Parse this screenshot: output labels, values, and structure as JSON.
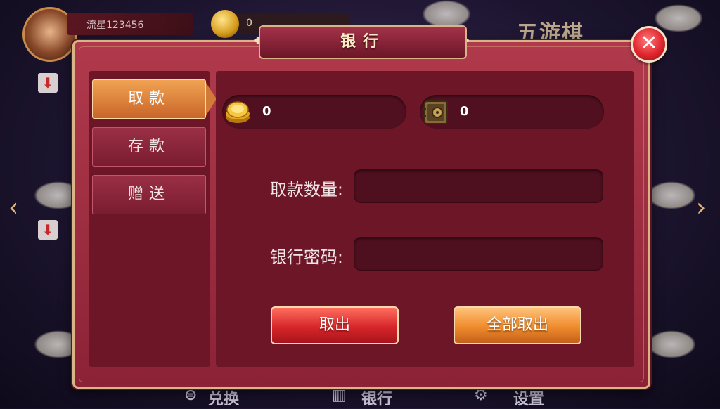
{
  "lobby": {
    "username": "流星123456",
    "coin_value": "0",
    "right_title": "五游棋",
    "bottom_nav": [
      {
        "label": "兑换",
        "icon": "exchange-icon"
      },
      {
        "label": "银行",
        "icon": "bank-icon"
      },
      {
        "label": "设置",
        "icon": "gear-icon"
      }
    ]
  },
  "dialog": {
    "title": "银行",
    "close_icon": "close-icon",
    "tabs": [
      {
        "label": "取款",
        "active": true
      },
      {
        "label": "存款",
        "active": false
      },
      {
        "label": "赠送",
        "active": false
      }
    ],
    "balances": {
      "gold": {
        "icon": "gold-coins-icon",
        "value": "0"
      },
      "bank": {
        "icon": "safe-icon",
        "value": "0"
      }
    },
    "fields": {
      "amount_label": "取款数量:",
      "amount_value": "",
      "password_label": "银行密码:",
      "password_value": ""
    },
    "buttons": {
      "withdraw": "取出",
      "withdraw_all": "全部取出"
    }
  },
  "colors": {
    "dialog_bg": "#8c2236",
    "panel_bg": "#6d1628",
    "frame_gold": "#d9b487",
    "active_tab": "#e0823a",
    "withdraw_button": "#d6262a",
    "withdraw_all_button": "#ef8b2c",
    "close_button": "#e0262e"
  }
}
